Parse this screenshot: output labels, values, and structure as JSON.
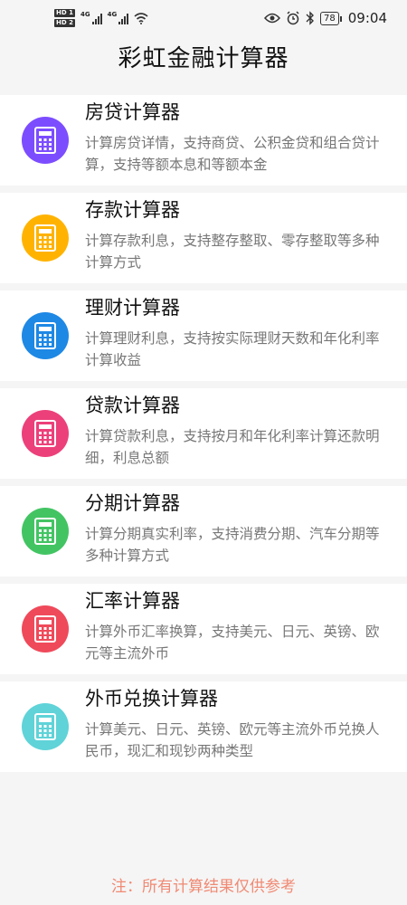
{
  "status_bar": {
    "hd1": "HD 1",
    "hd2": "HD 2",
    "net1": "4G",
    "net2": "4G",
    "battery": "78",
    "time": "09:04"
  },
  "app": {
    "title": "彩虹金融计算器"
  },
  "calculators": [
    {
      "title": "房贷计算器",
      "desc": "计算房贷详情，支持商贷、公积金贷和组合贷计算，支持等额本息和等额本金",
      "color": "#7c4dff"
    },
    {
      "title": "存款计算器",
      "desc": "计算存款利息，支持整存整取、零存整取等多种计算方式",
      "color": "#ffb300"
    },
    {
      "title": "理财计算器",
      "desc": "计算理财利息，支持按实际理财天数和年化利率计算收益",
      "color": "#1e88e5"
    },
    {
      "title": "贷款计算器",
      "desc": "计算贷款利息，支持按月和年化利率计算还款明细，利息总额",
      "color": "#ec407a"
    },
    {
      "title": "分期计算器",
      "desc": "计算分期真实利率，支持消费分期、汽车分期等多种计算方式",
      "color": "#43c463"
    },
    {
      "title": "汇率计算器",
      "desc": "计算外币汇率换算，支持美元、日元、英镑、欧元等主流外币",
      "color": "#ef4a5a"
    },
    {
      "title": "外币兑换计算器",
      "desc": "计算美元、日元、英镑、欧元等主流外币兑换人民币，现汇和现钞两种类型",
      "color": "#5fd3d8"
    }
  ],
  "footnote": "注：所有计算结果仅供参考",
  "icons": {
    "calculator": "calculator-icon"
  }
}
